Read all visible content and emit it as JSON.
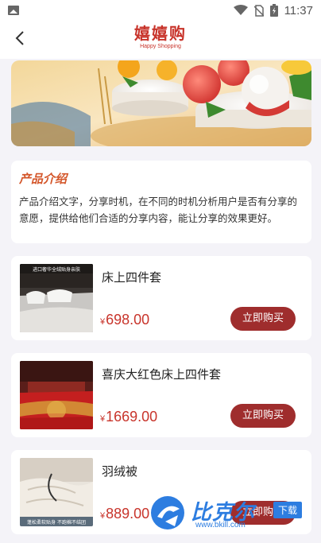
{
  "status_bar": {
    "time": "11:37"
  },
  "header": {
    "logo_cn": "嬉嬉购",
    "logo_en": "Happy Shopping"
  },
  "intro": {
    "title": "产品介绍",
    "text": "产品介绍文字，分享时机，在不同的时机分析用户是否有分享的意愿，提供给他们合适的分享内容，能让分享的效果更好。"
  },
  "products": [
    {
      "name": "床上四件套",
      "currency": "¥",
      "price": "698.00",
      "buy_label": "立即购买",
      "thumb_caption": "进口奢华全绒贴身亲肤"
    },
    {
      "name": "喜庆大红色床上四件套",
      "currency": "¥",
      "price": "1669.00",
      "buy_label": "立即购买"
    },
    {
      "name": "羽绒被",
      "currency": "¥",
      "price": "889.00",
      "buy_label": "立即购买",
      "thumb_caption": "蓬松柔软贴身 不跑棉不结团"
    }
  ],
  "watermark": {
    "brand": "比克尔",
    "download": "下载",
    "url": "www.bkill.com"
  },
  "colors": {
    "accent": "#c8342b",
    "button": "#9f2d2d",
    "intro_title": "#d4562a",
    "background": "#f4f3f8"
  }
}
